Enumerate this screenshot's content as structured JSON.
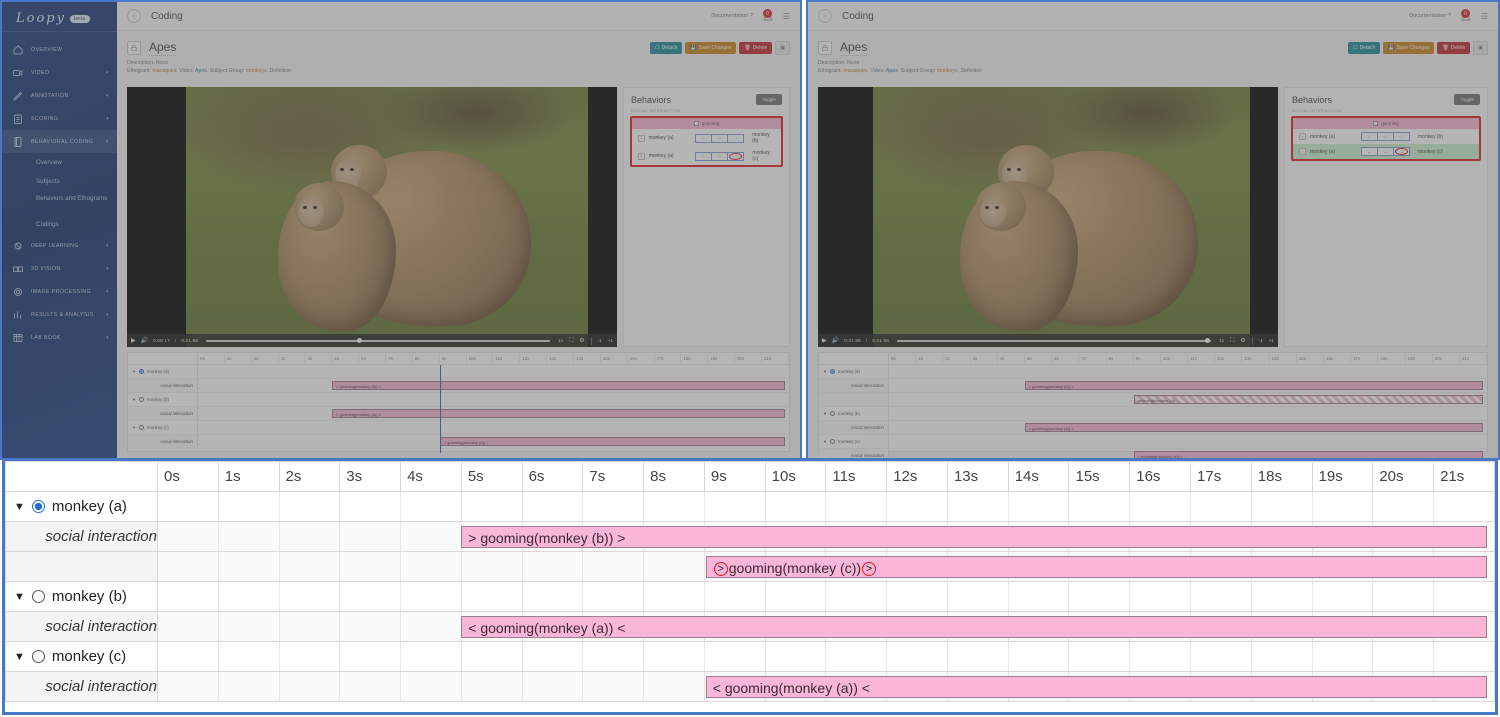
{
  "app": {
    "brand": "Loopy",
    "brand_pill": "beta"
  },
  "sidebar": {
    "items": [
      {
        "label": "OVERVIEW",
        "icon": "home-icon",
        "caret": ""
      },
      {
        "label": "VIDEO",
        "icon": "video-icon",
        "caret": "▾"
      },
      {
        "label": "ANNOTATION",
        "icon": "pencil-icon",
        "caret": "▾"
      },
      {
        "label": "SCORING",
        "icon": "clipboard-icon",
        "caret": "▾"
      },
      {
        "label": "BEHAVIORAL CODING",
        "icon": "notebook-icon",
        "caret": "▾"
      },
      {
        "label": "DEEP LEARNING",
        "icon": "brain-icon",
        "caret": "▾"
      },
      {
        "label": "3D VISION",
        "icon": "cube-icon",
        "caret": "▾"
      },
      {
        "label": "IMAGE PROCESSING",
        "icon": "gear-icon",
        "caret": "▾"
      },
      {
        "label": "RESULTS & ANALYSIS",
        "icon": "chart-icon",
        "caret": "▾"
      },
      {
        "label": "LAB BOOK",
        "icon": "book-icon",
        "caret": "▾"
      }
    ],
    "subitems": [
      {
        "label": "Overview"
      },
      {
        "label": "Subjects"
      },
      {
        "label": "Behaviors and Ethograms"
      },
      {
        "label": "Codings"
      }
    ]
  },
  "topbar": {
    "back_icon": "‹",
    "title": "Coding",
    "documentation": "Documentation ?",
    "badge_count": "0",
    "menu_icon": "☰"
  },
  "page": {
    "lock_icon": "□",
    "title": "Apes",
    "description_label": "Description:",
    "description_value": "None",
    "meta_prefix": "Ethogram:",
    "ethogram": "macaques",
    "video_label": "Video:",
    "video_value": "Apes",
    "subject_group_label": "Subject Group:",
    "subject_group_value": "monkeys",
    "definition_label": "Definition",
    "actions": {
      "detach": "Detach",
      "save": "Save Changes",
      "delete": "Delete",
      "more": "▣"
    }
  },
  "video": {
    "play_icon": "▶",
    "volume_icon": "🔊",
    "time_left": "0:09.17",
    "time_sep": "/",
    "time_total": "0:21.98",
    "time_left_right_pane": "0:21.98",
    "speed": "1x",
    "fullscreen_icon": "⛶",
    "settings_icon": "⚙",
    "frame_back": "-1",
    "frame_fwd": "+1"
  },
  "behaviors": {
    "title": "Behaviors",
    "toggle_button": "Toggle",
    "group_label": "SOCIAL INTERACTION",
    "behavior_name": "gooming",
    "rows": [
      {
        "index": "1",
        "actor": "monkey (a)",
        "target": "monkey (b)",
        "arrows": [
          "←",
          "↔",
          "→"
        ],
        "selected_arrow": -1,
        "highlight": false
      },
      {
        "index": "2",
        "actor": "monkey (a)",
        "target": "monkey (c)",
        "arrows": [
          "←",
          "↔",
          "→"
        ],
        "selected_arrow": 2,
        "highlight": true
      }
    ]
  },
  "timeline": {
    "ticks": [
      "0s",
      "1s",
      "2s",
      "3s",
      "4s",
      "5s",
      "6s",
      "7s",
      "8s",
      "9s",
      "10s",
      "11s",
      "12s",
      "13s",
      "14s",
      "15s",
      "16s",
      "17s",
      "18s",
      "19s",
      "20s",
      "21s"
    ],
    "behavior_row_label": "social interaction",
    "subjects": [
      {
        "name": "monkey (a)",
        "selected": true,
        "caret": "▼"
      },
      {
        "name": "monkey (b)",
        "selected": false,
        "caret": "▼"
      },
      {
        "name": "monkey (c)",
        "selected": false,
        "caret": "▼"
      }
    ],
    "bars": [
      {
        "subject": "monkey (a)",
        "row": 0,
        "label": "> gooming(monkey (b)) >",
        "start_s": 5.0,
        "end_s": 21.8,
        "circled": false,
        "hatched": false
      },
      {
        "subject": "monkey (a)",
        "row": 1,
        "label": "gooming(monkey (c))",
        "prefix_circled": ">",
        "suffix_circled": ">",
        "start_s": 9.0,
        "end_s": 21.8,
        "circled": true,
        "hatched": false
      },
      {
        "subject": "monkey (b)",
        "row": 0,
        "label": "< gooming(monkey (a)) <",
        "start_s": 5.0,
        "end_s": 21.8,
        "circled": false,
        "hatched": false
      },
      {
        "subject": "monkey (c)",
        "row": 0,
        "label": "< gooming(monkey (a)) <",
        "start_s": 9.0,
        "end_s": 21.8,
        "circled": false,
        "hatched": false
      }
    ],
    "playhead_s": 9.0,
    "right_pane_hatched_bar": {
      "label": "gooming(monkey (c))",
      "start_s": 9.0,
      "end_s": 21.8
    }
  },
  "colors": {
    "accent_blue": "#4a78c8",
    "sidebar_blue": "#1b3a7a",
    "bar_pink": "#f9b6d8",
    "highlight_red": "#e01b24",
    "highlight_green": "#c9f0cd",
    "detach_teal": "#1b8a9c",
    "save_orange": "#c9801a",
    "delete_red": "#c0262e"
  }
}
